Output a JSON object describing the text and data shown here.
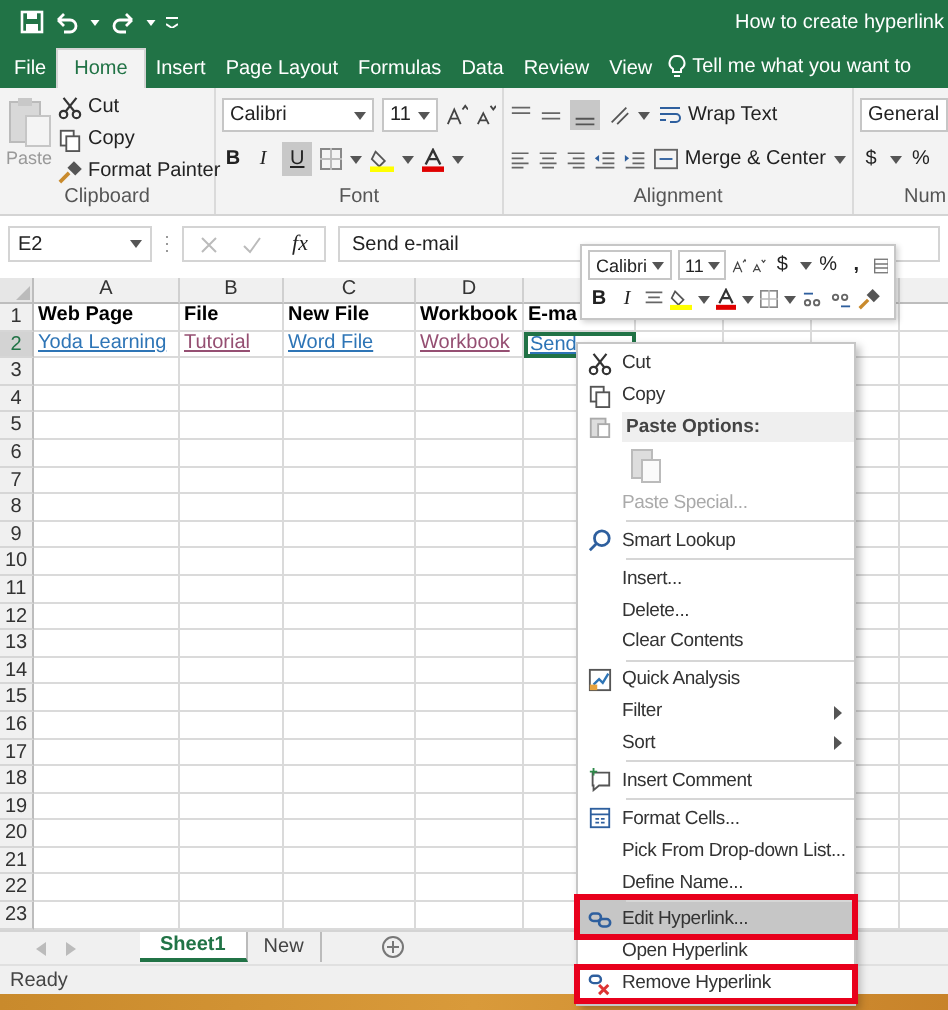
{
  "window": {
    "title": "How to create hyperlink"
  },
  "ribbon_tabs": [
    {
      "label": "File",
      "selected": false
    },
    {
      "label": "Home",
      "selected": true
    },
    {
      "label": "Insert",
      "selected": false
    },
    {
      "label": "Page Layout",
      "selected": false
    },
    {
      "label": "Formulas",
      "selected": false
    },
    {
      "label": "Data",
      "selected": false
    },
    {
      "label": "Review",
      "selected": false
    },
    {
      "label": "View",
      "selected": false
    }
  ],
  "tell_me": "Tell me what you want to",
  "clipboard": {
    "paste": "Paste",
    "cut": "Cut",
    "copy": "Copy",
    "format_painter": "Format Painter",
    "label": "Clipboard"
  },
  "font": {
    "name": "Calibri",
    "size": "11",
    "bold": "B",
    "italic": "I",
    "underline": "U",
    "underline_on": true,
    "label": "Font"
  },
  "alignment": {
    "wrap_text": "Wrap Text",
    "merge": "Merge & Center",
    "label": "Alignment"
  },
  "number": {
    "format": "General",
    "currency": "$",
    "percent": "%",
    "label": "Num"
  },
  "formula_bar": {
    "name_box": "E2",
    "fx": "fx",
    "value": "Send e-mail"
  },
  "columns": [
    "A",
    "B",
    "C",
    "D"
  ],
  "rows": [
    {
      "number": "1",
      "selected": false,
      "cells": [
        {
          "text": "Web Page",
          "kind": "heading"
        },
        {
          "text": "File",
          "kind": "heading"
        },
        {
          "text": "New File",
          "kind": "heading"
        },
        {
          "text": "Workbook",
          "kind": "heading"
        },
        {
          "text": "E-ma",
          "kind": "heading"
        }
      ]
    },
    {
      "number": "2",
      "selected": true,
      "cells": [
        {
          "text": "Yoda Learning",
          "kind": "link",
          "visited": false,
          "selected": false
        },
        {
          "text": "Tutorial",
          "kind": "link",
          "visited": true,
          "selected": false
        },
        {
          "text": "Word File",
          "kind": "link",
          "visited": false,
          "selected": false
        },
        {
          "text": "Workbook",
          "kind": "link",
          "visited": true,
          "selected": false
        },
        {
          "text": "Send",
          "kind": "link",
          "visited": false,
          "selected": true
        }
      ]
    },
    {
      "number": "3",
      "selected": false
    },
    {
      "number": "4",
      "selected": false
    },
    {
      "number": "5",
      "selected": false
    },
    {
      "number": "6",
      "selected": false
    },
    {
      "number": "7",
      "selected": false
    },
    {
      "number": "8",
      "selected": false
    },
    {
      "number": "9",
      "selected": false
    },
    {
      "number": "10",
      "selected": false
    },
    {
      "number": "11",
      "selected": false
    },
    {
      "number": "12",
      "selected": false
    },
    {
      "number": "13",
      "selected": false
    },
    {
      "number": "14",
      "selected": false
    },
    {
      "number": "15",
      "selected": false
    },
    {
      "number": "16",
      "selected": false
    },
    {
      "number": "17",
      "selected": false
    },
    {
      "number": "18",
      "selected": false
    },
    {
      "number": "19",
      "selected": false
    },
    {
      "number": "20",
      "selected": false
    },
    {
      "number": "21",
      "selected": false
    },
    {
      "number": "22",
      "selected": false
    },
    {
      "number": "23",
      "selected": false
    }
  ],
  "sheet_tabs": [
    {
      "label": "Sheet1",
      "selected": true
    },
    {
      "label": "New",
      "selected": false
    }
  ],
  "status_bar": "Ready",
  "mini_toolbar": {
    "font": "Calibri",
    "size": "11",
    "currency": "$",
    "percent": "%",
    "comma": ",",
    "bold": "B",
    "italic": "I"
  },
  "context_menu": [
    {
      "label": "Cut",
      "kind": "item",
      "disabled": false,
      "selected": false,
      "outlined": false,
      "submenu": false,
      "separator_before": false
    },
    {
      "label": "Copy",
      "kind": "item",
      "disabled": false,
      "selected": false,
      "outlined": false,
      "submenu": false,
      "separator_before": false
    },
    {
      "label": "Paste Options:",
      "kind": "header"
    },
    {
      "kind": "paste-icon"
    },
    {
      "label": "Paste Special...",
      "kind": "item",
      "disabled": true,
      "selected": false,
      "outlined": false,
      "submenu": false,
      "separator_before": false
    },
    {
      "label": "Smart Lookup",
      "kind": "item",
      "disabled": false,
      "selected": false,
      "outlined": false,
      "submenu": false,
      "separator_before": true
    },
    {
      "label": "Insert...",
      "kind": "item",
      "disabled": false,
      "selected": false,
      "outlined": false,
      "submenu": false,
      "separator_before": true
    },
    {
      "label": "Delete...",
      "kind": "item",
      "disabled": false,
      "selected": false,
      "outlined": false,
      "submenu": false,
      "separator_before": false
    },
    {
      "label": "Clear Contents",
      "kind": "item",
      "disabled": false,
      "selected": false,
      "outlined": false,
      "submenu": false,
      "separator_before": false
    },
    {
      "label": "Quick Analysis",
      "kind": "item",
      "disabled": false,
      "selected": false,
      "outlined": false,
      "submenu": false,
      "separator_before": true
    },
    {
      "label": "Filter",
      "kind": "item",
      "disabled": false,
      "selected": false,
      "outlined": false,
      "submenu": true,
      "separator_before": false
    },
    {
      "label": "Sort",
      "kind": "item",
      "disabled": false,
      "selected": false,
      "outlined": false,
      "submenu": true,
      "separator_before": false
    },
    {
      "label": "Insert Comment",
      "kind": "item",
      "disabled": false,
      "selected": false,
      "outlined": false,
      "submenu": false,
      "separator_before": true
    },
    {
      "label": "Format Cells...",
      "kind": "item",
      "disabled": false,
      "selected": false,
      "outlined": false,
      "submenu": false,
      "separator_before": true
    },
    {
      "label": "Pick From Drop-down List...",
      "kind": "item",
      "disabled": false,
      "selected": false,
      "outlined": false,
      "submenu": false,
      "separator_before": false
    },
    {
      "label": "Define Name...",
      "kind": "item",
      "disabled": false,
      "selected": false,
      "outlined": false,
      "submenu": false,
      "separator_before": false
    },
    {
      "label": "Edit Hyperlink...",
      "kind": "item",
      "disabled": false,
      "selected": true,
      "outlined": true,
      "submenu": false,
      "separator_before": true
    },
    {
      "label": "Open Hyperlink",
      "kind": "item",
      "disabled": false,
      "selected": false,
      "outlined": false,
      "submenu": false,
      "separator_before": false
    },
    {
      "label": "Remove Hyperlink",
      "kind": "item",
      "disabled": false,
      "selected": false,
      "outlined": true,
      "submenu": false,
      "separator_before": false
    }
  ]
}
